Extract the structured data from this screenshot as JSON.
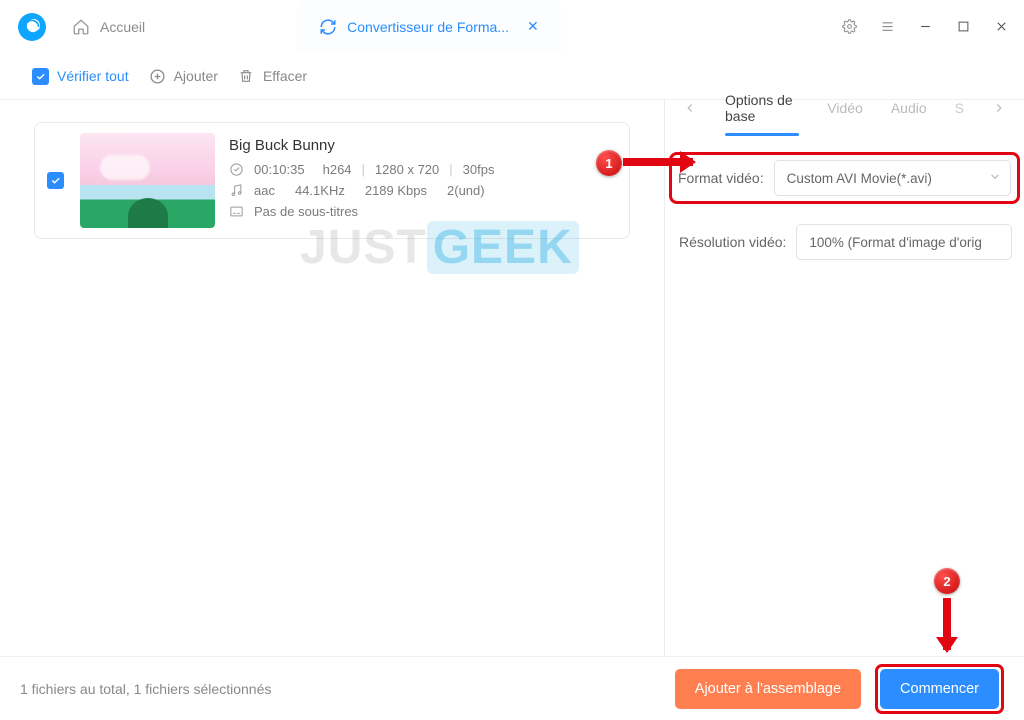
{
  "titlebar": {
    "tabs": {
      "home_label": "Accueil",
      "converter_label": "Convertisseur de Forma..."
    }
  },
  "toolbar": {
    "verify_label": "Vérifier tout",
    "add_label": "Ajouter",
    "clear_label": "Effacer"
  },
  "file": {
    "title": "Big Buck Bunny",
    "duration": "00:10:35",
    "vcodec": "h264",
    "resolution": "1280  x  720",
    "fps": "30fps",
    "acodec": "aac",
    "arate": "44.1KHz",
    "abitrate": "2189 Kbps",
    "channels": "2(und)",
    "subtitle": "Pas de sous-titres"
  },
  "right": {
    "tabs": {
      "base": "Options de base",
      "video": "Vidéo",
      "audio": "Audio",
      "s": "S"
    },
    "format_label": "Format vidéo:",
    "format_value": "Custom AVI Movie(*.avi)",
    "res_label": "Résolution vidéo:",
    "res_value": "100% (Format d'image d'orig"
  },
  "footer": {
    "status": "1 fichiers au total, 1 fichiers sélectionnés",
    "assemble": "Ajouter à l'assemblage",
    "start": "Commencer"
  },
  "annot": {
    "n1": "1",
    "n2": "2"
  },
  "watermark": {
    "a": "JUST",
    "b": "GEEK"
  }
}
